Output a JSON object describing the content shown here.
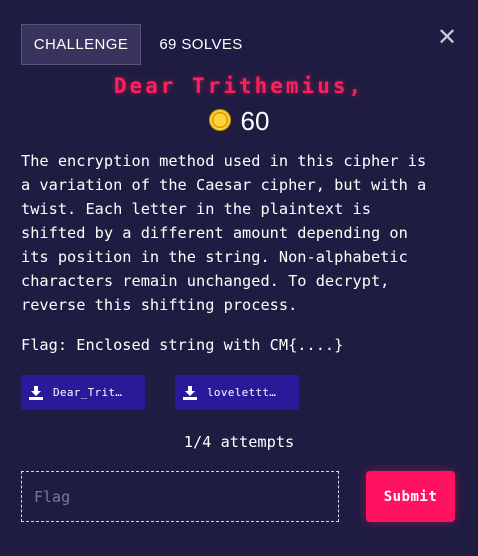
{
  "header": {
    "tabs": [
      {
        "label": "CHALLENGE",
        "active": true
      },
      {
        "label": "69 SOLVES",
        "active": false
      }
    ],
    "close_icon": "close-icon"
  },
  "challenge": {
    "title": "Dear Trithemius,",
    "points": "60",
    "points_icon": "coin-icon",
    "description": [
      "The encryption method used in this cipher is",
      "a variation of the Caesar cipher, but with a",
      "twist. Each letter in the plaintext is",
      "shifted by a different amount depending on",
      "its position in the string. Non-alphabetic",
      "characters remain unchanged. To decrypt,",
      "reverse this shifting process."
    ],
    "flag_hint": "Flag: Enclosed string with CM{....}"
  },
  "files": [
    {
      "name": "Dear_Trit…",
      "icon": "download-icon"
    },
    {
      "name": "lovelettt…",
      "icon": "download-icon"
    }
  ],
  "attempts": "1/4 attempts",
  "form": {
    "flag_placeholder": "Flag",
    "flag_value": "",
    "submit_label": "Submit"
  },
  "colors": {
    "background": "#1f1c42",
    "accent": "#ff1360",
    "title": "#ff1f5a",
    "file_button": "#2a1a9a",
    "coin": "#ffd43a"
  }
}
